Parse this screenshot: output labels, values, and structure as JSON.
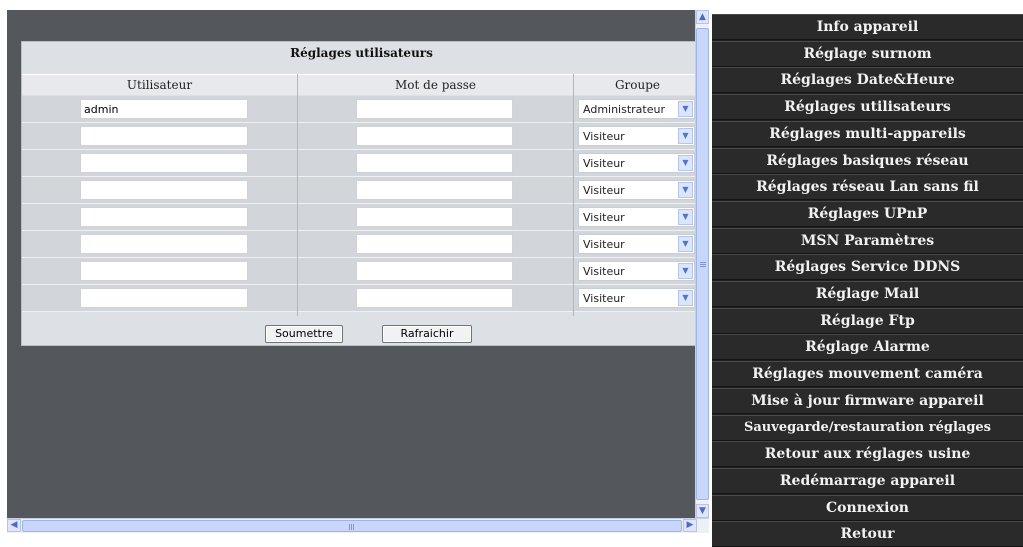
{
  "panel": {
    "title": "Réglages utilisateurs",
    "columns": {
      "user": "Utilisateur",
      "password": "Mot de passe",
      "group": "Groupe"
    },
    "rows": [
      {
        "user": "admin",
        "password": "",
        "group": "Administrateur"
      },
      {
        "user": "",
        "password": "",
        "group": "Visiteur"
      },
      {
        "user": "",
        "password": "",
        "group": "Visiteur"
      },
      {
        "user": "",
        "password": "",
        "group": "Visiteur"
      },
      {
        "user": "",
        "password": "",
        "group": "Visiteur"
      },
      {
        "user": "",
        "password": "",
        "group": "Visiteur"
      },
      {
        "user": "",
        "password": "",
        "group": "Visiteur"
      },
      {
        "user": "",
        "password": "",
        "group": "Visiteur"
      }
    ],
    "submit_label": "Soumettre",
    "refresh_label": "Rafraichir"
  },
  "menu": {
    "items": [
      "Info appareil",
      "Réglage surnom",
      "Réglages Date&Heure",
      "Réglages utilisateurs",
      "Réglages multi-appareils",
      "Réglages basiques réseau",
      "Réglages réseau Lan sans fil",
      "Réglages UPnP",
      "MSN Paramètres",
      "Réglages Service DDNS",
      "Réglage Mail",
      "Réglage Ftp",
      "Réglage Alarme",
      "Réglages mouvement caméra",
      "Mise à jour firmware appareil",
      "Sauvegarde/restauration réglages",
      "Retour aux réglages usine",
      "Redémarrage appareil",
      "Connexion",
      "Retour"
    ]
  },
  "scrollbar": {
    "up_icon": "arrow-up-icon",
    "down_icon": "arrow-down-icon",
    "left_icon": "arrow-left-icon",
    "right_icon": "arrow-right-icon"
  },
  "colors": {
    "menu_background": "#2a2a2a",
    "menu_text": "#f2f2f2",
    "content_background": "#54585c",
    "panel_background": "#dde0e4"
  }
}
